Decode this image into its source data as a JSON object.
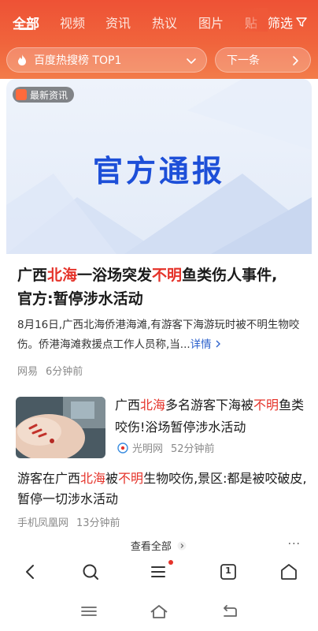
{
  "tabs": [
    {
      "label": "全部",
      "active": true
    },
    {
      "label": "视频"
    },
    {
      "label": "资讯"
    },
    {
      "label": "热议"
    },
    {
      "label": "图片"
    },
    {
      "label": "贴"
    }
  ],
  "filter_label": "筛选",
  "hot_pill": {
    "label": "百度热搜榜 TOP1",
    "icon": "flame-icon"
  },
  "next_pill": {
    "label": "下一条"
  },
  "card": {
    "badge": "最新资讯",
    "banner_title": "官方通报",
    "headline_parts": [
      "广西",
      "北海",
      "一浴场突发",
      "不明",
      "鱼类伤人事件,",
      "官方:暂停涉水活动"
    ],
    "summary": "8月16日,广西北海侨港海滩,有游客下海游玩时被不明生物咬伤。侨港海滩救援点工作人员称,当...",
    "summary_link": "详情",
    "source": "网易",
    "time": "6分钟前"
  },
  "story2": {
    "title_parts": [
      "广西",
      "北海",
      "多名游客下海被",
      "不明",
      "鱼类咬伤!浴场暂停涉水活动"
    ],
    "source": "光明网",
    "time": "52分钟前"
  },
  "story3": {
    "title_parts": [
      "游客在广西",
      "北海",
      "被",
      "不明",
      "生物咬伤,景区:都是被咬破皮,暂停一切涉水活动"
    ],
    "source": "手机凤凰网",
    "time": "13分钟前"
  },
  "see_all": "查看全部",
  "toolbar": {
    "tab_count": "1",
    "icons": [
      "back-icon",
      "search-icon",
      "menu-icon",
      "tabs-icon",
      "home-icon"
    ]
  },
  "colors": {
    "accent": "#ee5235",
    "highlight": "#e5332a",
    "banner_title": "#1d4fd8",
    "link": "#2e62cc"
  }
}
